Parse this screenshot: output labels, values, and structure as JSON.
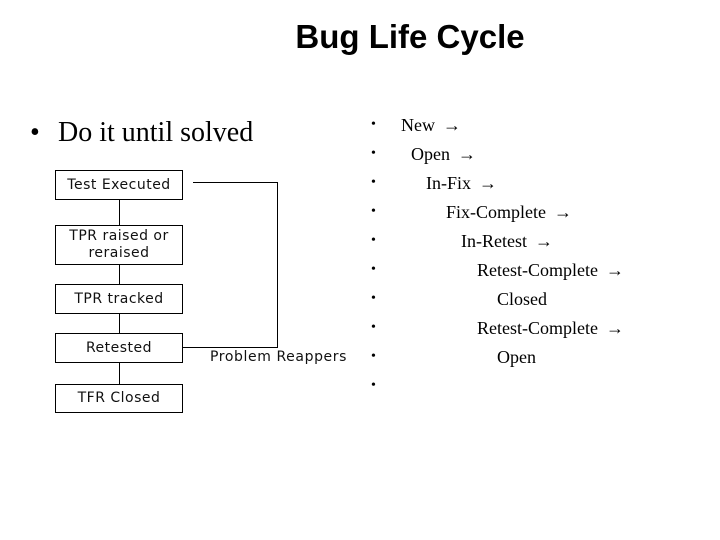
{
  "slide": {
    "title": "Bug Life Cycle",
    "left_bullet": {
      "bullet": "•",
      "text": "Do it until solved"
    },
    "flowchart": {
      "boxes": [
        {
          "label": "Test Executed"
        },
        {
          "label": "TPR raised or reraised"
        },
        {
          "label": "TPR tracked"
        },
        {
          "label": "Retested"
        },
        {
          "label": "TFR Closed"
        }
      ],
      "feedback_label": "Problem Reappers"
    },
    "right_list": {
      "bullet": "•",
      "items": [
        {
          "text": "New",
          "arrow": "→",
          "indent_level": 0
        },
        {
          "text": "Open",
          "arrow": "→",
          "indent_level": 1
        },
        {
          "text": "In-Fix",
          "arrow": "→",
          "indent_level": 2
        },
        {
          "text": "Fix-Complete",
          "arrow": "→",
          "indent_level": 3
        },
        {
          "text": "In-Retest",
          "arrow": "→",
          "indent_level": 4
        },
        {
          "text": "Retest-Complete",
          "arrow": "→",
          "indent_level": 5
        },
        {
          "text": "Closed",
          "arrow": "",
          "indent_level": 6
        },
        {
          "text": "Retest-Complete",
          "arrow": "→",
          "indent_level": 5
        },
        {
          "text": "Open",
          "arrow": "",
          "indent_level": 6
        },
        {
          "text": "",
          "arrow": "",
          "indent_level": 0
        }
      ]
    }
  }
}
